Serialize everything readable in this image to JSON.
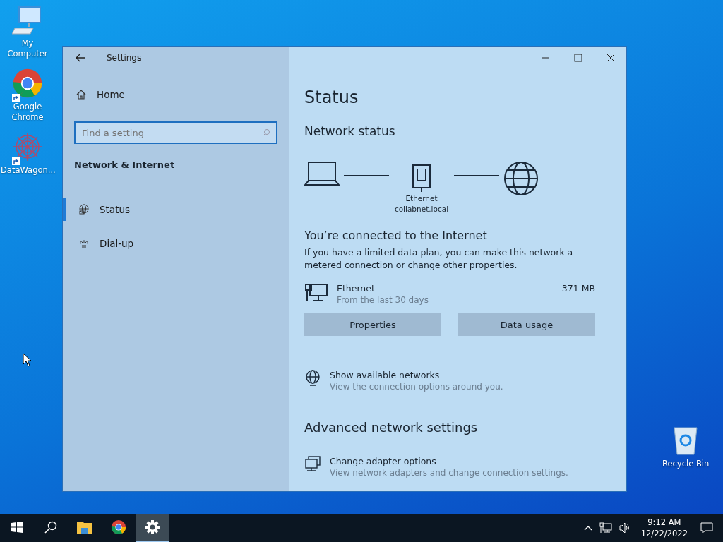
{
  "desktop_icons": [
    {
      "kind": "computer",
      "label": "My Computer",
      "shortcut": false
    },
    {
      "kind": "chrome",
      "label": "Google Chrome",
      "shortcut": true
    },
    {
      "kind": "snowflake",
      "label": "DataWagon...",
      "shortcut": true
    }
  ],
  "recycle_bin": {
    "label": "Recycle Bin"
  },
  "window": {
    "title": "Settings",
    "home": "Home",
    "search": {
      "placeholder": "Find a setting"
    },
    "section": "Network & Internet",
    "nav": [
      {
        "kind": "globe",
        "label": "Status",
        "selected": true
      },
      {
        "kind": "phone",
        "label": "Dial-up",
        "selected": false
      }
    ]
  },
  "content": {
    "heading": "Status",
    "subheading": "Network status",
    "diagram": {
      "adapter": "Ethernet",
      "network": "collabnet.local"
    },
    "connected_title": "You’re connected to the Internet",
    "connected_text": "If you have a limited data plan, you can make this network a metered connection or change other properties.",
    "connection": {
      "name": "Ethernet",
      "period": "From the last 30 days",
      "usage": "371 MB"
    },
    "buttons": [
      "Properties",
      "Data usage"
    ],
    "links": [
      {
        "kind": "globe",
        "title": "Show available networks",
        "description": "View the connection options around you."
      }
    ],
    "advanced_heading": "Advanced network settings",
    "advanced_links": [
      {
        "kind": "adapter",
        "title": "Change adapter options",
        "description": "View network adapters and change connection settings."
      }
    ]
  },
  "taskbar": {
    "apps": [
      {
        "kind": "folder",
        "selected": false
      },
      {
        "kind": "chrome",
        "selected": false
      },
      {
        "kind": "gear",
        "selected": true
      }
    ],
    "time": "9:12 AM",
    "date": "12/22/2022"
  }
}
